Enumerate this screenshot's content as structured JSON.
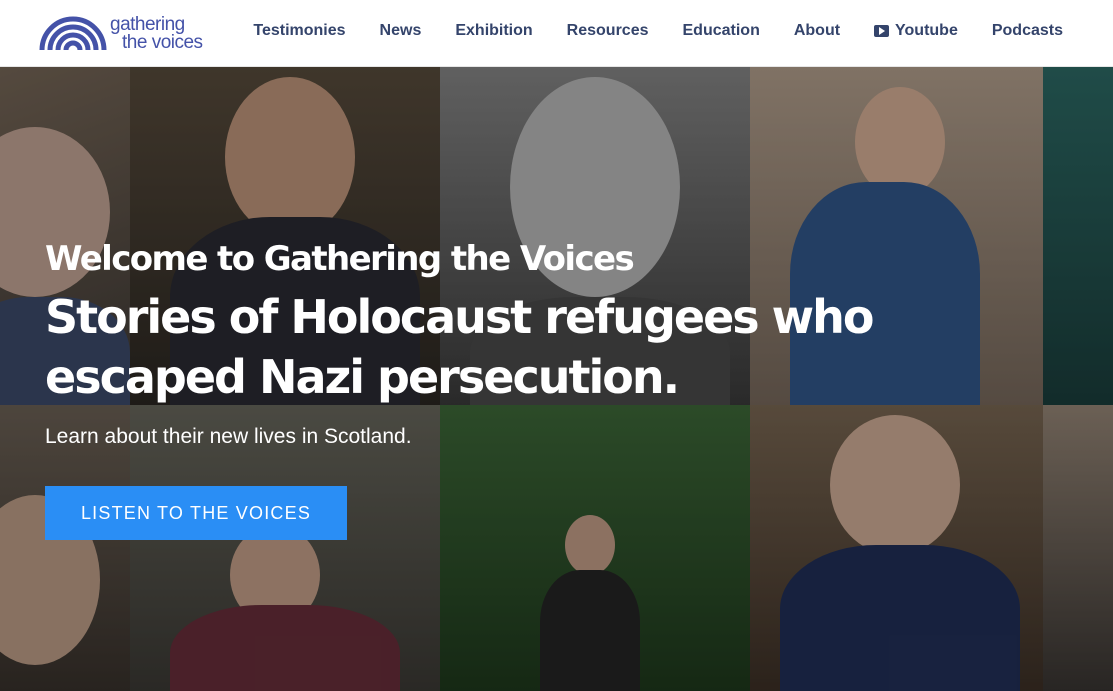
{
  "header": {
    "logo": {
      "line1": "gathering",
      "line2": "the voices"
    },
    "nav": [
      {
        "label": "Testimonies"
      },
      {
        "label": "News"
      },
      {
        "label": "Exhibition"
      },
      {
        "label": "Resources"
      },
      {
        "label": "Education"
      },
      {
        "label": "About"
      },
      {
        "label": "Youtube",
        "icon": "youtube-icon"
      },
      {
        "label": "Podcasts"
      }
    ]
  },
  "hero": {
    "eyebrow": "Welcome to Gathering the Voices",
    "headline": "Stories of Holocaust refugees who escaped Nazi persecution.",
    "subheading": "Learn about their new lives in Scotland.",
    "cta_label": "LISTEN TO THE VOICES",
    "background": "collage of portrait photographs"
  },
  "colors": {
    "brand": "#4452a8",
    "nav_text": "#34446b",
    "cta": "#2a8ef5",
    "header_bg": "#ffffff"
  }
}
